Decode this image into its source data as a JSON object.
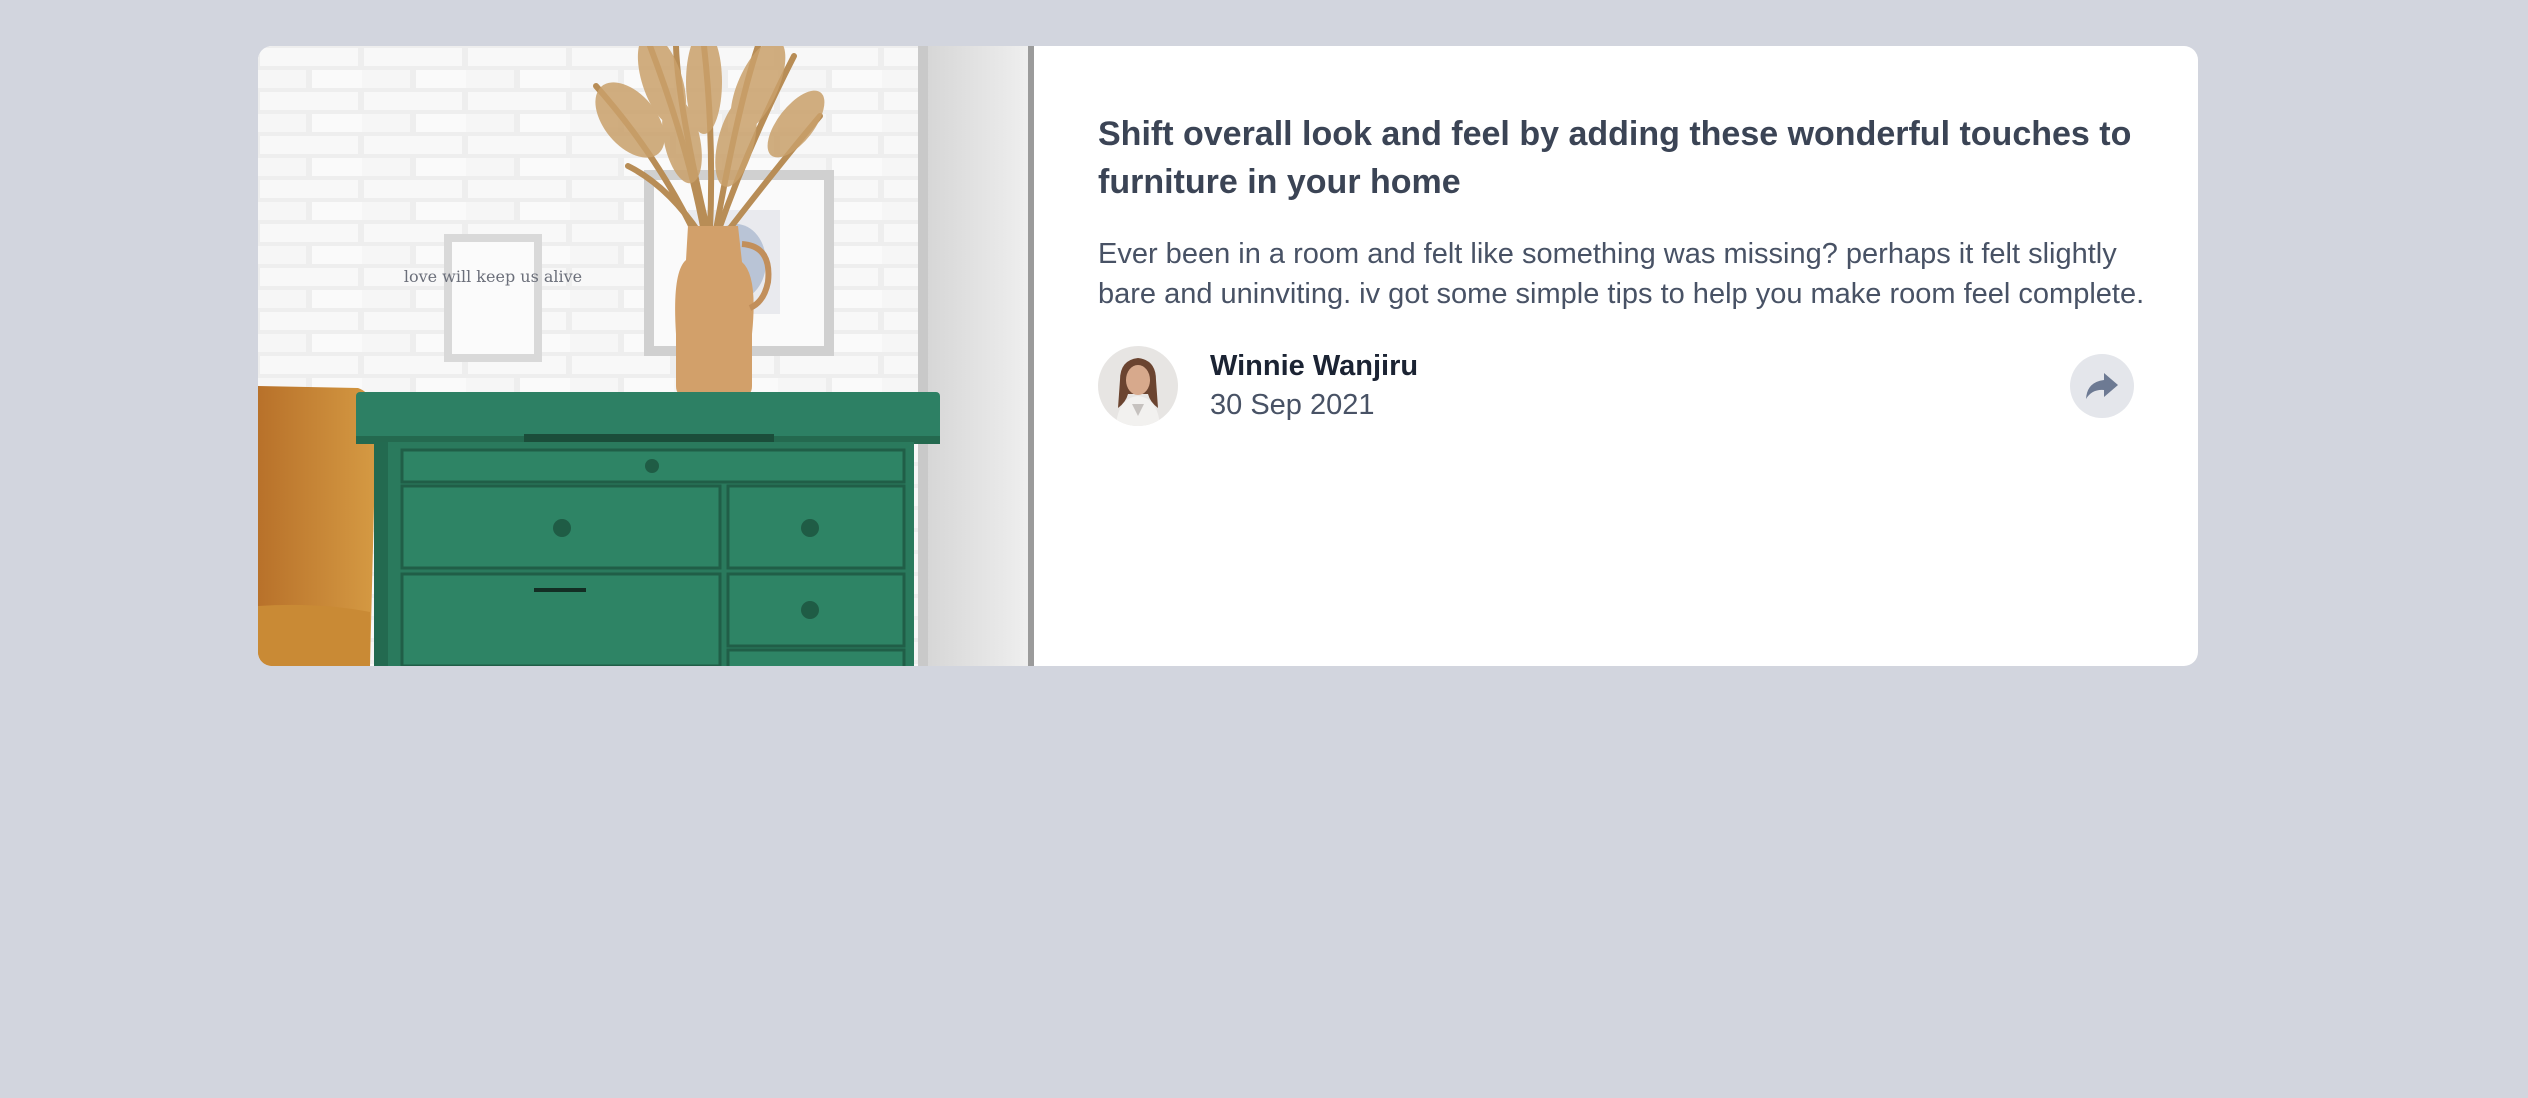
{
  "card": {
    "title": "Shift overall look and feel by adding these wonderful touches to furniture in your home",
    "excerpt": "Ever been in a room and felt like something was missing? perhaps it felt slightly bare and uninviting. iv got some simple tips to help you make room feel complete.",
    "image_alt": "Green drawer cabinet with framed prints and dried pampas grass in a vase against a white brick wall",
    "frame_text": "love will keep us alive",
    "author": {
      "name": "Winnie Wanjiru",
      "date": "30 Sep 2021"
    },
    "share_icon": "share-arrow-icon"
  },
  "colors": {
    "page_background": "#d2d5de",
    "card_background": "#ffffff",
    "title": "#3b4455",
    "body_text": "#485265",
    "share_button_bg": "#e4e6eb",
    "share_icon": "#6d7a93"
  }
}
